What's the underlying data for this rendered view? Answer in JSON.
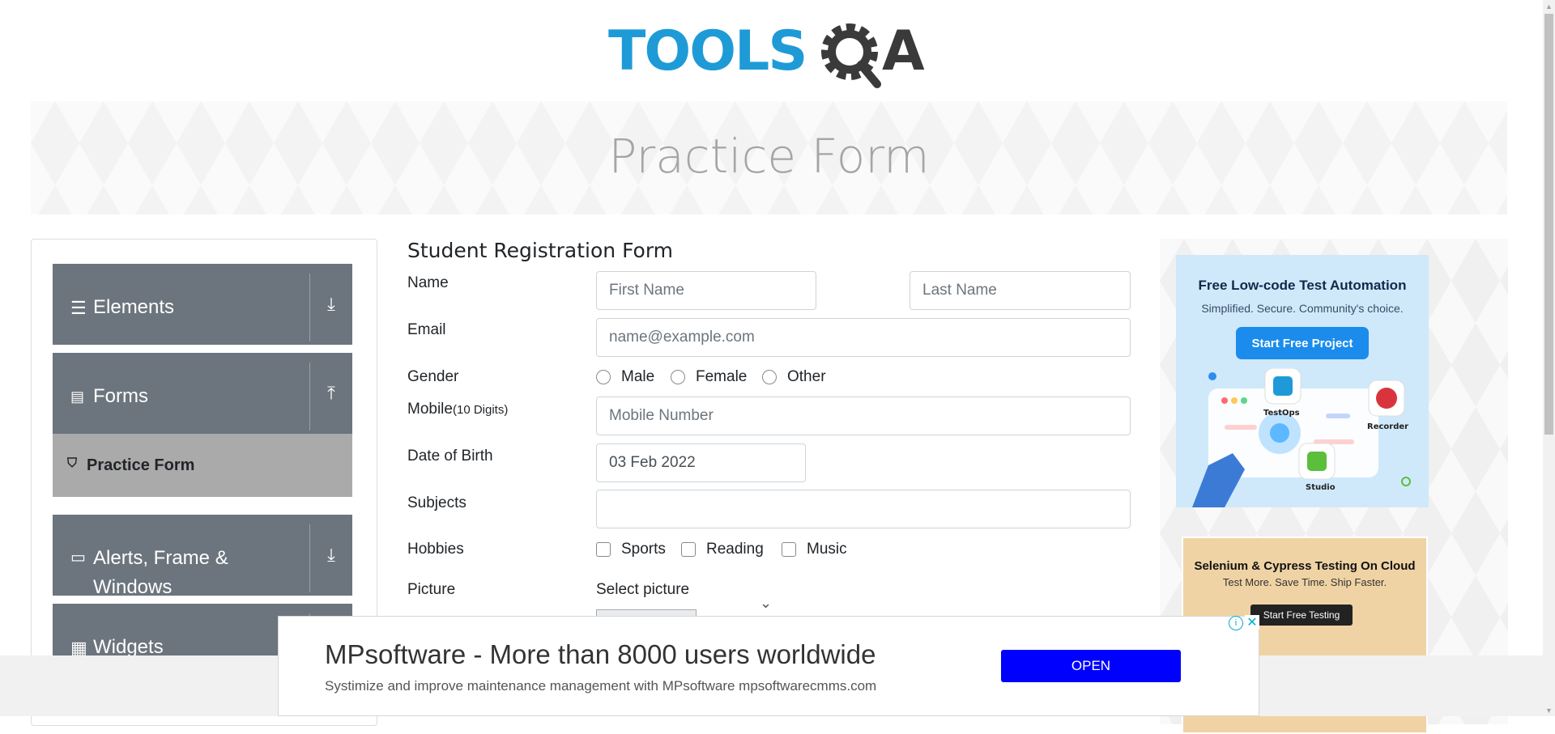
{
  "header": {
    "logo_text": "TOOLSQA",
    "banner_title": "Practice Form"
  },
  "sidebar": {
    "groups": [
      {
        "label": "Elements",
        "icon": "hamburger-icon",
        "arrow": "download-arrow-icon"
      },
      {
        "label": "Forms",
        "icon": "document-icon",
        "arrow": "upload-arrow-icon"
      },
      {
        "label": "Alerts, Frame & Windows",
        "icon": "window-icon",
        "arrow": "download-arrow-icon"
      },
      {
        "label": "Widgets",
        "icon": "widgets-icon",
        "arrow": "download-arrow-icon"
      }
    ],
    "active_item": {
      "label": "Practice Form",
      "icon": "html5-icon"
    }
  },
  "form": {
    "title": "Student Registration Form",
    "name_label": "Name",
    "first_name_placeholder": "First Name",
    "last_name_placeholder": "Last Name",
    "email_label": "Email",
    "email_placeholder": "name@example.com",
    "gender_label": "Gender",
    "gender_options": [
      "Male",
      "Female",
      "Other"
    ],
    "mobile_label": "Mobile",
    "mobile_hint": "(10 Digits)",
    "mobile_placeholder": "Mobile Number",
    "dob_label": "Date of Birth",
    "dob_value": "03 Feb 2022",
    "subjects_label": "Subjects",
    "hobbies_label": "Hobbies",
    "hobby_options": [
      "Sports",
      "Reading",
      "Music"
    ],
    "picture_label": "Picture",
    "picture_select_label": "Select picture"
  },
  "ads": {
    "ad1": {
      "title": "Free Low-code Test Automation",
      "subtitle": "Simplified. Secure. Community's choice.",
      "button": "Start Free Project",
      "labels": [
        "TestOps",
        "Recorder",
        "Studio"
      ]
    },
    "ad2": {
      "title": "Selenium & Cypress Testing On Cloud",
      "subtitle": "Test More. Save Time. Ship Faster.",
      "button": "Start Free Testing"
    },
    "bottom": {
      "title": "MPsoftware - More than 8000 users worldwide",
      "subtitle": "Systimize and improve maintenance management with MPsoftware mpsoftwarecmms.com",
      "button": "OPEN"
    }
  },
  "colors": {
    "logo_blue": "#1e9bd7",
    "logo_dark": "#3a3a3a",
    "sidebar_group_bg": "#6c757d",
    "active_item_bg": "#aaaaaa",
    "ad_button_blue": "#0000ff"
  }
}
